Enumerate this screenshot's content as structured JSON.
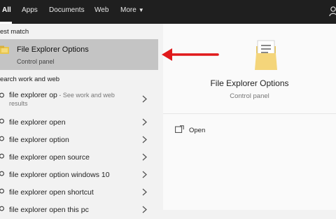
{
  "tabs": [
    {
      "label": "All"
    },
    {
      "label": "Apps"
    },
    {
      "label": "Documents"
    },
    {
      "label": "Web"
    },
    {
      "label": "More"
    }
  ],
  "left": {
    "best_match_header": "est match",
    "best_match": {
      "title": "File Explorer Options",
      "subtitle": "Control panel",
      "icon": "folder-icon"
    },
    "search_header": "earch work and web",
    "results": [
      {
        "text": "file explorer op",
        "extra": " - See work and web",
        "extra2": "results"
      },
      {
        "text": "file explorer open"
      },
      {
        "text": "file explorer option"
      },
      {
        "text": "file explorer open source"
      },
      {
        "text": "file explorer option windows 10"
      },
      {
        "text": "file explorer open shortcut"
      },
      {
        "text": "file explorer open this pc"
      }
    ]
  },
  "preview": {
    "title": "File Explorer Options",
    "subtitle": "Control panel",
    "icon": "folder-icon",
    "actions": [
      {
        "label": "Open",
        "icon": "open-window-icon"
      }
    ]
  },
  "colors": {
    "topbar": "#1f1f1f",
    "selected": "#c4c4c4",
    "arrow": "#e0191b"
  }
}
